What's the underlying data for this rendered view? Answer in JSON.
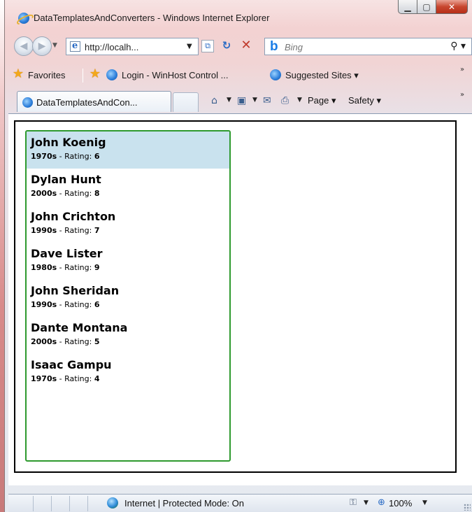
{
  "window": {
    "title": "DataTemplatesAndConverters - Windows Internet Explorer"
  },
  "nav": {
    "address": "http://localh...",
    "search_placeholder": "Bing",
    "bing_mark": "b"
  },
  "favorites": {
    "favorites_label": "Favorites",
    "items": [
      {
        "label": "Login - WinHost Control ..."
      },
      {
        "label": "Suggested Sites ▾"
      }
    ]
  },
  "tabs": {
    "active_tab": "DataTemplatesAndCon..."
  },
  "commands": {
    "page_label": "Page ▾",
    "safety_label": "Safety ▾"
  },
  "list": {
    "selected_index": 0,
    "rating_label": " - Rating: ",
    "items": [
      {
        "name": "John Koenig",
        "decade": "1970s",
        "rating": "6"
      },
      {
        "name": "Dylan Hunt",
        "decade": "2000s",
        "rating": "8"
      },
      {
        "name": "John Crichton",
        "decade": "1990s",
        "rating": "7"
      },
      {
        "name": "Dave Lister",
        "decade": "1980s",
        "rating": "9"
      },
      {
        "name": "John Sheridan",
        "decade": "1990s",
        "rating": "6"
      },
      {
        "name": "Dante Montana",
        "decade": "2000s",
        "rating": "5"
      },
      {
        "name": "Isaac Gampu",
        "decade": "1970s",
        "rating": "4"
      }
    ]
  },
  "status": {
    "zone_text": "Internet | Protected Mode: On",
    "zoom": "100%"
  },
  "colors": {
    "list_border": "#2e9a2e",
    "selected_background": "#c9e2ee"
  }
}
